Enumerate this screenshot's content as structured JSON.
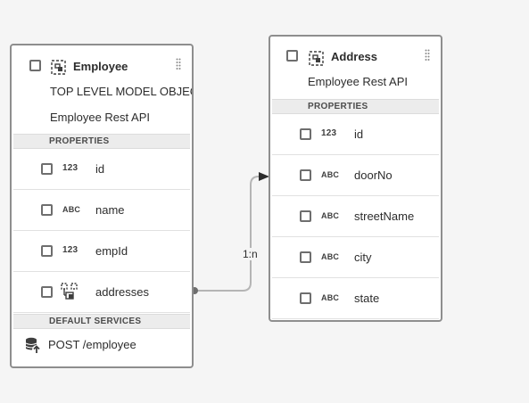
{
  "canvas": {
    "background": "#f5f5f5",
    "card_border_color": "#8e8e8e",
    "connector_color": "#b5b5b5"
  },
  "relationship": {
    "label": "1:n",
    "from_icon": "relationship-dot-icon",
    "to_icon": "arrowhead-icon"
  },
  "employee": {
    "title": "Employee",
    "icon": "model-icon",
    "subtitle": "TOP LEVEL MODEL OBJECT",
    "source": "Employee Rest API",
    "properties_label": "PROPERTIES",
    "properties": [
      {
        "type": "123",
        "name": "id",
        "icon": "integer-type-icon"
      },
      {
        "type": "ABC",
        "name": "name",
        "icon": "string-type-icon"
      },
      {
        "type": "123",
        "name": "empId",
        "icon": "integer-type-icon"
      },
      {
        "type": "relation",
        "name": "addresses",
        "icon": "relationship-icon"
      }
    ],
    "services_label": "DEFAULT SERVICES",
    "services": [
      {
        "label": "POST /employee",
        "icon": "database-upload-icon"
      }
    ]
  },
  "address": {
    "title": "Address",
    "icon": "model-icon",
    "source": "Employee Rest API",
    "properties_label": "PROPERTIES",
    "properties": [
      {
        "type": "123",
        "name": "id",
        "icon": "integer-type-icon"
      },
      {
        "type": "ABC",
        "name": "doorNo",
        "icon": "string-type-icon"
      },
      {
        "type": "ABC",
        "name": "streetName",
        "icon": "string-type-icon"
      },
      {
        "type": "ABC",
        "name": "city",
        "icon": "string-type-icon"
      },
      {
        "type": "ABC",
        "name": "state",
        "icon": "string-type-icon"
      }
    ]
  }
}
